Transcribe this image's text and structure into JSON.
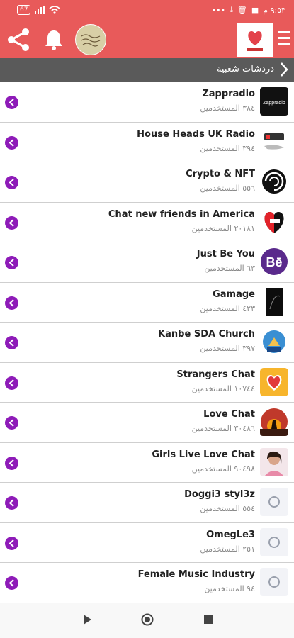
{
  "status": {
    "time": "٩:٥٣ م",
    "battery": "67"
  },
  "section": {
    "title": "دردشات شعبية"
  },
  "users_label": "المستخدمين",
  "accent": "#e85a5a",
  "go_color": "#8e1bb8",
  "rooms": [
    {
      "name": "Zappradio",
      "users": "٣٨٤",
      "thumb_label": "Zappradio",
      "icon": "zappradio-logo"
    },
    {
      "name": "House Heads UK Radio",
      "users": "٣٩٤",
      "icon": "radio-icon"
    },
    {
      "name": "Crypto & NFT",
      "users": "٥٥٦",
      "icon": "spiral-icon"
    },
    {
      "name": "Chat new friends in America",
      "users": "٢٠١٨١",
      "icon": "heart-flag-icon"
    },
    {
      "name": "Just Be You",
      "users": "٦٣",
      "thumb_label": "Bē",
      "icon": "behance-icon"
    },
    {
      "name": "Gamage",
      "users": "٤٢٣",
      "icon": "dark-swirl-icon"
    },
    {
      "name": "Kanbe SDA Church",
      "users": "٣٩٧",
      "icon": "church-icon"
    },
    {
      "name": "Strangers Chat",
      "users": "١٠٧٤٤",
      "icon": "heart-icon"
    },
    {
      "name": "Love Chat",
      "users": "٣٠٤٨٦",
      "icon": "sunset-icon"
    },
    {
      "name": "Girls Live Love Chat",
      "users": "٩٠٤٩٨",
      "icon": "portrait-icon"
    },
    {
      "name": "Doggi3 styl3z",
      "users": "٥٥٤",
      "icon": "placeholder-icon"
    },
    {
      "name": "OmegLe3",
      "users": "٢٥١",
      "icon": "placeholder-icon"
    },
    {
      "name": "Female Music Industry",
      "users": "٩٤",
      "icon": "placeholder-icon"
    }
  ]
}
